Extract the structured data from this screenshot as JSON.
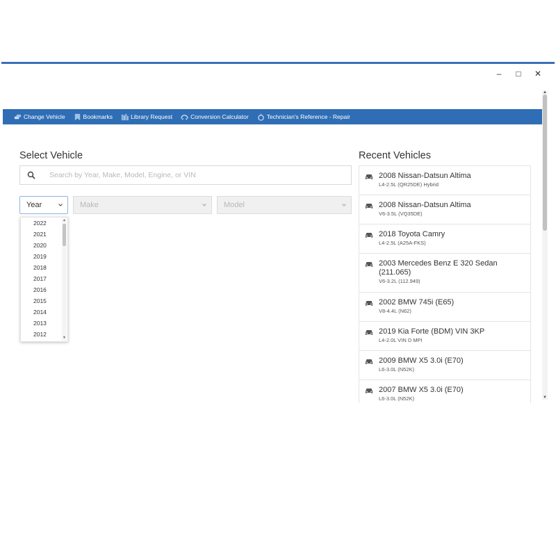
{
  "window": {
    "controls": {
      "minimize": "–",
      "maximize": "□",
      "close": "✕"
    }
  },
  "nav": {
    "items": [
      {
        "label": "Change Vehicle",
        "icon": "car-swap-icon"
      },
      {
        "label": "Bookmarks",
        "icon": "bookmark-icon"
      },
      {
        "label": "Library Request",
        "icon": "library-icon"
      },
      {
        "label": "Conversion Calculator",
        "icon": "calculator-icon"
      },
      {
        "label": "Technician's Reference - Repair",
        "icon": "technician-icon"
      }
    ]
  },
  "select_vehicle": {
    "title": "Select Vehicle",
    "search_placeholder": "Search by Year, Make, Model, Engine, or VIN",
    "year_label": "Year",
    "make_label": "Make",
    "model_label": "Model",
    "year_options": [
      "2022",
      "2021",
      "2020",
      "2019",
      "2018",
      "2017",
      "2016",
      "2015",
      "2014",
      "2013",
      "2012"
    ]
  },
  "recent": {
    "title": "Recent Vehicles",
    "items": [
      {
        "name": "2008 Nissan-Datsun Altima",
        "engine": "L4-2.5L (QR25DE) Hybrid"
      },
      {
        "name": "2008 Nissan-Datsun Altima",
        "engine": "V6-3.5L (VQ35DE)"
      },
      {
        "name": "2018 Toyota Camry",
        "engine": "L4-2.5L (A25A-FKS)"
      },
      {
        "name": "2003 Mercedes Benz E 320 Sedan (211.065)",
        "engine": "V6-3.2L (112.949)"
      },
      {
        "name": "2002 BMW 745i (E65)",
        "engine": "V8-4.4L (N62)"
      },
      {
        "name": "2019 Kia Forte (BDM) VIN 3KP",
        "engine": "L4-2.0L VIN D MPI"
      },
      {
        "name": "2009 BMW X5 3.0i (E70)",
        "engine": "L6-3.0L (N52K)"
      },
      {
        "name": "2007 BMW X5 3.0i (E70)",
        "engine": "L6-3.0L (N52K)"
      }
    ]
  },
  "colors": {
    "nav_bg": "#2f6eb5",
    "window_border": "#3b6fb6",
    "active_select_border": "#8fb3e0"
  }
}
